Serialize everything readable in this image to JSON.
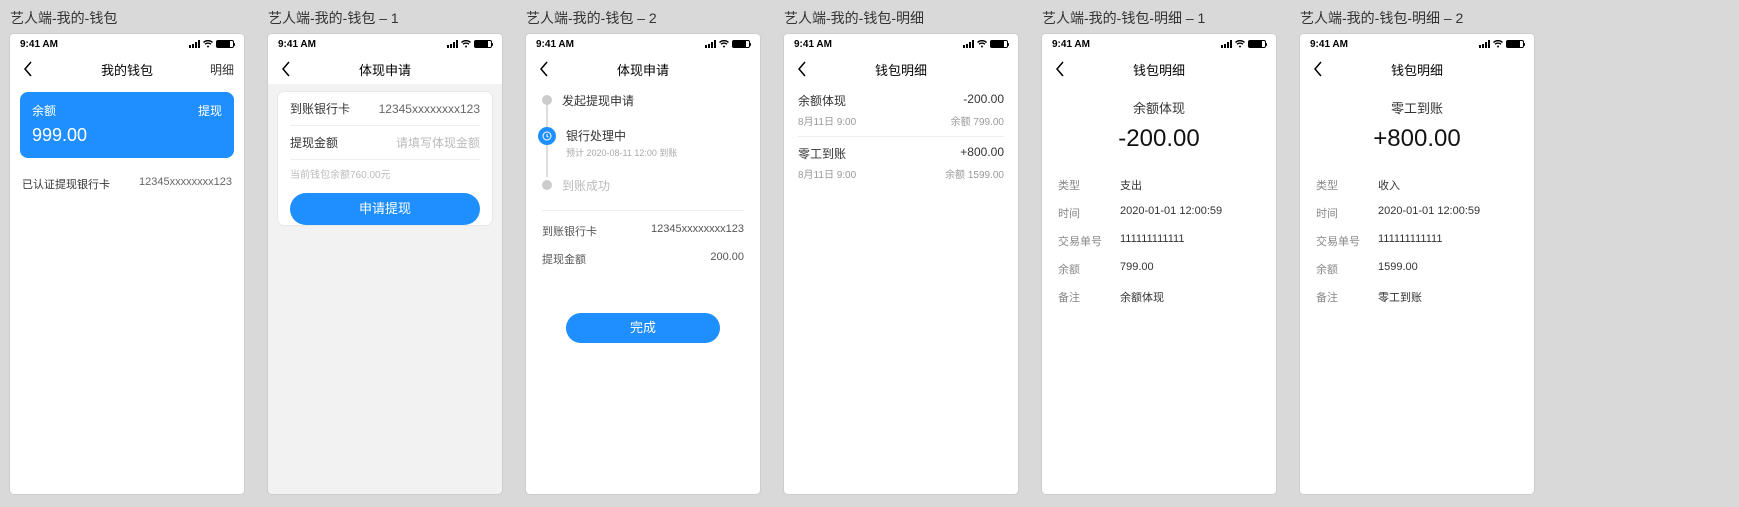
{
  "statusbar_time": "9:41 AM",
  "boards": [
    {
      "title": "艺人端-我的-钱包",
      "nav_title": "我的钱包",
      "nav_right": "明细"
    },
    {
      "title": "艺人端-我的-钱包 – 1",
      "nav_title": "体现申请"
    },
    {
      "title": "艺人端-我的-钱包 – 2",
      "nav_title": "体现申请"
    },
    {
      "title": "艺人端-我的-钱包-明细",
      "nav_title": "钱包明细"
    },
    {
      "title": "艺人端-我的-钱包-明细 – 1",
      "nav_title": "钱包明细"
    },
    {
      "title": "艺人端-我的-钱包-明细 – 2",
      "nav_title": "钱包明细"
    }
  ],
  "s1": {
    "balance_label": "余额",
    "withdraw_label": "提现",
    "balance_amount": "999.00",
    "bank_label": "已认证提现银行卡",
    "bank_value": "12345xxxxxxxx123"
  },
  "s2": {
    "row1_label": "到账银行卡",
    "row1_value": "12345xxxxxxxx123",
    "row2_label": "提现金额",
    "row2_placeholder": "请填写体现金额",
    "hint": "当前钱包余额760.00元",
    "submit": "申请提现"
  },
  "s3": {
    "step1_title": "发起提现申请",
    "step2_title": "银行处理中",
    "step2_sub": "预计 2020-08-11 12:00 到账",
    "step3_title": "到账成功",
    "kv1_k": "到账银行卡",
    "kv1_v": "12345xxxxxxxx123",
    "kv2_k": "提现金额",
    "kv2_v": "200.00",
    "done": "完成"
  },
  "s4": {
    "rows": [
      {
        "title": "余额体现",
        "amount": "-200.00",
        "time": "8月11日 9:00",
        "bal": "余额 799.00"
      },
      {
        "title": "零工到账",
        "amount": "+800.00",
        "time": "8月11日 9:00",
        "bal": "余额 1599.00"
      }
    ]
  },
  "s5": {
    "big_title": "余额体现",
    "big_amount": "-200.00",
    "kvs": [
      {
        "k": "类型",
        "v": "支出"
      },
      {
        "k": "时间",
        "v": "2020-01-01 12:00:59"
      },
      {
        "k": "交易单号",
        "v": "111111111111"
      },
      {
        "k": "余额",
        "v": "799.00"
      },
      {
        "k": "备注",
        "v": "余额体现"
      }
    ]
  },
  "s6": {
    "big_title": "零工到账",
    "big_amount": "+800.00",
    "kvs": [
      {
        "k": "类型",
        "v": "收入"
      },
      {
        "k": "时间",
        "v": "2020-01-01 12:00:59"
      },
      {
        "k": "交易单号",
        "v": "111111111111"
      },
      {
        "k": "余额",
        "v": "1599.00"
      },
      {
        "k": "备注",
        "v": "零工到账"
      }
    ]
  }
}
